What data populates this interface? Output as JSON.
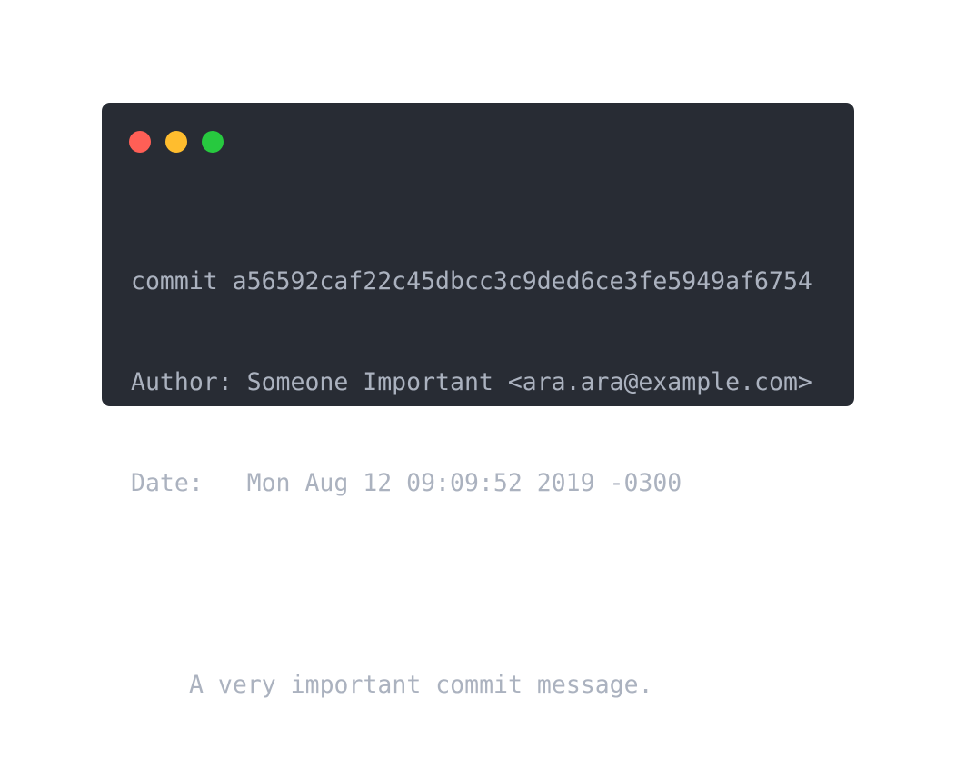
{
  "window": {
    "background": "#282c34",
    "controls": [
      {
        "name": "close",
        "color": "#ff5f56"
      },
      {
        "name": "minimize",
        "color": "#ffbd2e"
      },
      {
        "name": "maximize",
        "color": "#27c93f"
      }
    ]
  },
  "terminal": {
    "text_color": "#abb2bf",
    "lines": {
      "commit": "commit a56592caf22c45dbcc3c9ded6ce3fe5949af6754",
      "author": "Author: Someone Important <ara.ara@example.com>",
      "date": "Date:   Mon Aug 12 09:09:52 2019 -0300",
      "message": "A very important commit message."
    }
  }
}
